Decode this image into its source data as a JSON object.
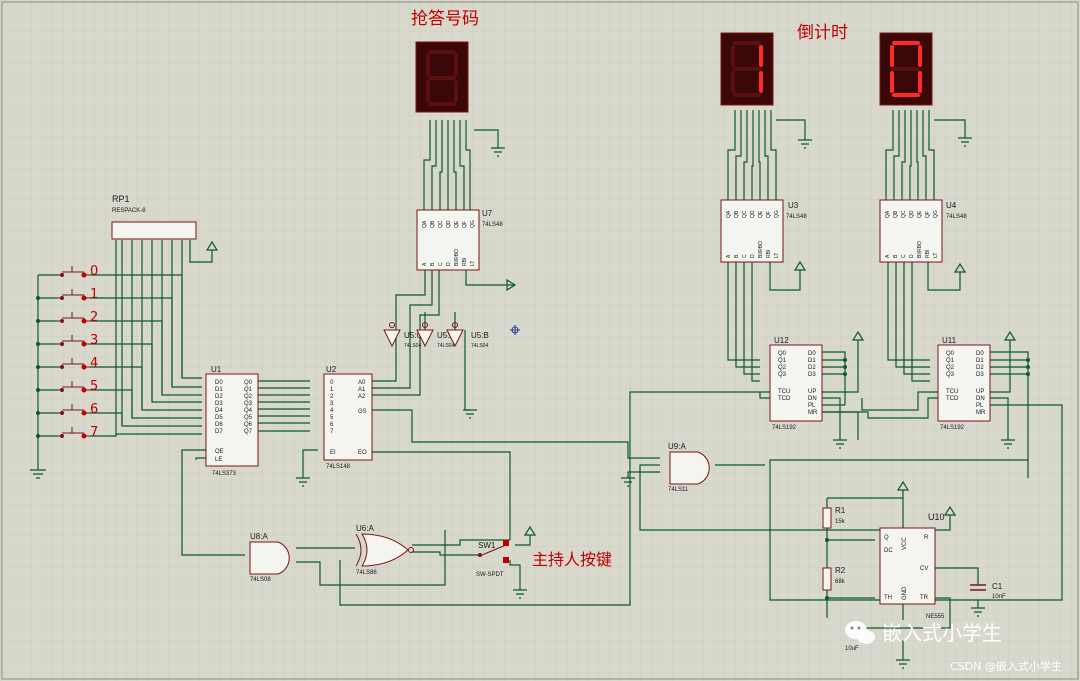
{
  "headings": {
    "answer_number": "抢答号码",
    "countdown": "倒计时"
  },
  "displays": {
    "answer_digit": "8",
    "countdown_tens": "1",
    "countdown_ones": "0"
  },
  "rp1": {
    "ref": "RP1",
    "value": "RESPACK-8"
  },
  "buttons": [
    "0",
    "1",
    "2",
    "3",
    "4",
    "5",
    "6",
    "7"
  ],
  "u1": {
    "ref": "U1",
    "part": "74LS373",
    "in_pins": [
      "D0",
      "D1",
      "D2",
      "D3",
      "D4",
      "D5",
      "D6",
      "D7"
    ],
    "out_pins": [
      "Q0",
      "Q1",
      "Q2",
      "Q3",
      "Q4",
      "Q5",
      "Q6",
      "Q7"
    ],
    "oe": "OE",
    "le": "LE"
  },
  "u2": {
    "ref": "U2",
    "part": "74LS148",
    "in_pins": [
      "0",
      "1",
      "2",
      "3",
      "4",
      "5",
      "6",
      "7"
    ],
    "out_pins": [
      "A0",
      "A1",
      "A2"
    ],
    "gs": "GS",
    "ei": "EI",
    "eo": "EO"
  },
  "u7": {
    "ref": "U7",
    "part": "74LS48",
    "top_pins": [
      "QA",
      "QB",
      "QC",
      "QD",
      "QE",
      "QF",
      "QG"
    ],
    "bot_pins": [
      "A",
      "B",
      "C",
      "D",
      "BI/RBO",
      "RBI",
      "LT"
    ]
  },
  "u3": {
    "ref": "U3",
    "part": "74LS48"
  },
  "u4": {
    "ref": "U4",
    "part": "74LS48"
  },
  "u5c": {
    "ref": "U5:C",
    "part": "74LS04"
  },
  "u5a": {
    "ref": "U5:A",
    "part": "74LS04"
  },
  "u5b": {
    "ref": "U5:B",
    "part": "74LS04"
  },
  "u12": {
    "ref": "U12",
    "part": "74LS192"
  },
  "u11": {
    "ref": "U11",
    "part": "74LS192"
  },
  "u192": {
    "left_pins": [
      "Q0",
      "Q1",
      "Q2",
      "Q3",
      "TCU",
      "TCD"
    ],
    "right_pins": [
      "D0",
      "D1",
      "D2",
      "D3",
      "UP",
      "DN",
      "PL",
      "MR"
    ]
  },
  "u9a": {
    "ref": "U9:A",
    "part": "74LS11"
  },
  "u8a": {
    "ref": "U8:A",
    "part": "74LS08"
  },
  "u6a": {
    "ref": "U6:A",
    "part": "74LS86"
  },
  "sw1": {
    "ref": "SW1",
    "part": "SW-SPDT",
    "label": "主持人按键"
  },
  "u10": {
    "ref": "U10",
    "part": "NE555",
    "pins": [
      "Q",
      "DC",
      "TH",
      "GND",
      "TR",
      "CV",
      "R",
      "VCC"
    ]
  },
  "r1": {
    "ref": "R1",
    "value": "15k"
  },
  "r2": {
    "ref": "R2",
    "value": "68k"
  },
  "c1": {
    "ref": "C1",
    "value": "10nF"
  },
  "c2": {
    "value": "10uF"
  },
  "watermark": "嵌入式小学生",
  "csdn": "CSDN @嵌入式小学生",
  "colors": {
    "wire": "#0b5a2a",
    "part": "#7a1414",
    "body": "#f4f4f0",
    "grid": "#c4c4b8",
    "segment_on": "#ff2a2a",
    "segment_off": "#5a1010"
  }
}
